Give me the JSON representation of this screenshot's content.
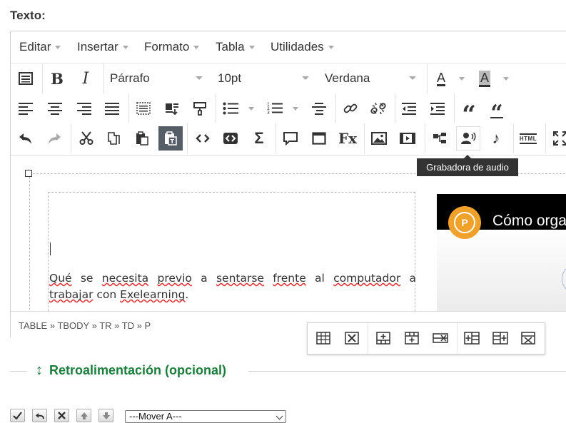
{
  "section_label": "Texto:",
  "menubar": {
    "items": [
      "Editar",
      "Insertar",
      "Formato",
      "Tabla",
      "Utilidades"
    ]
  },
  "toolbar": {
    "format_select": "Párrafo",
    "size_select": "10pt",
    "font_select": "Verdana",
    "text_color_glyph": "A",
    "bg_color_glyph": "A",
    "icons_row1": [
      "source-code-icon",
      "bold-icon",
      "italic-icon",
      "font-color-icon",
      "background-color-icon"
    ],
    "icons_row2": [
      "align-left-icon",
      "align-center-icon",
      "align-right-icon",
      "justify-icon",
      "select-all-icon",
      "paste-text-icon",
      "format-painter-icon",
      "bullet-list-icon",
      "numbered-list-icon",
      "list-indent-icon",
      "link-icon",
      "unlink-icon",
      "outdent-icon",
      "indent-icon",
      "blockquote-icon",
      "quote-icon"
    ],
    "icons_row3": [
      "undo-icon",
      "redo-icon",
      "cut-icon",
      "copy-icon",
      "paste-icon",
      "paste-word-icon",
      "code-icon",
      "code-block-icon",
      "sigma-icon",
      "comment-icon",
      "fullscreen-window-icon",
      "formula-icon",
      "image-icon",
      "media-icon",
      "mindmap-icon",
      "audio-recorder-icon",
      "music-icon",
      "html-icon",
      "expand-icon"
    ],
    "bold_glyph": "B",
    "italic_glyph": "I",
    "sigma_glyph": "Σ",
    "fx_glyph": "Fx",
    "quote_glyph": "“",
    "music_glyph": "♪",
    "html_glyph": "HTML"
  },
  "tooltip": "Grabadora de audio",
  "content": {
    "paragraph_words": [
      "Qué",
      " se ",
      "necesita",
      " ",
      "previo",
      " a ",
      "sentarse",
      " ",
      "frente",
      " al ",
      "computador",
      " a ",
      "trabajar",
      " con ",
      "Exelearning",
      "."
    ],
    "misspelled_indices": [
      0,
      2,
      4,
      6,
      8,
      10,
      12,
      14
    ],
    "video": {
      "title": "Cómo orga",
      "logo_letter": "P"
    }
  },
  "statusbar": {
    "path": "TABLE » TBODY » TR » TD » P"
  },
  "table_popup": {
    "icons": [
      "table-properties-icon",
      "delete-table-icon",
      "insert-row-before-icon",
      "insert-row-after-icon",
      "delete-row-icon",
      "insert-column-before-icon",
      "insert-column-after-icon",
      "delete-column-icon"
    ]
  },
  "feedback": {
    "arrow": "↕",
    "title": "Retroalimentación (opcional)"
  },
  "bottom_controls": {
    "icons": [
      "check-icon",
      "undo-icon",
      "delete-icon",
      "move-up-icon",
      "move-down-icon"
    ],
    "move_select": "---Mover A---"
  },
  "colors": {
    "accent_green": "#1b7d3c",
    "active_button": "#555d66",
    "tooltip_bg": "#333333",
    "video_logo": "#f0a12a",
    "spell_underline": "#dd3333"
  }
}
